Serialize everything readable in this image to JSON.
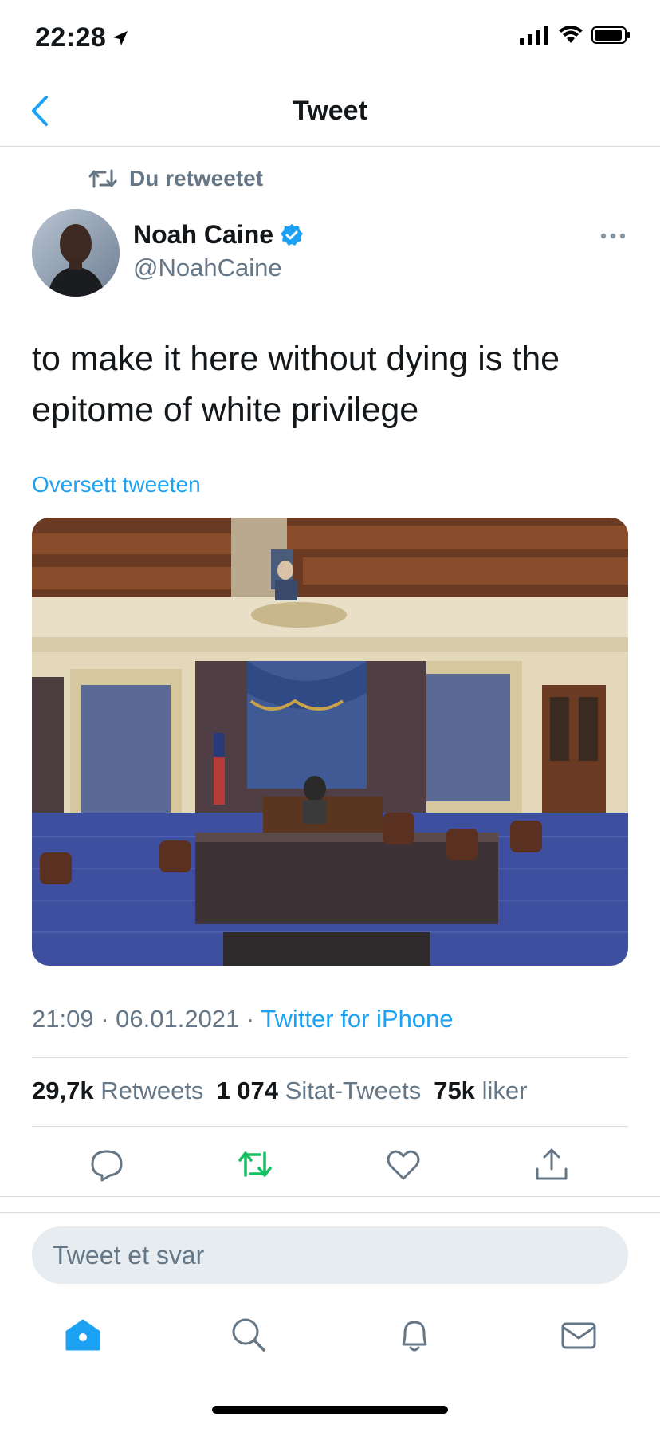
{
  "status_bar": {
    "time": "22:28"
  },
  "nav": {
    "title": "Tweet"
  },
  "retweet_notice": "Du retweetet",
  "author": {
    "name": "Noah Caine",
    "handle": "@NoahCaine"
  },
  "tweet": {
    "text": "to make it here without dying is the epitome of white privilege",
    "translate_label": "Oversett tweeten",
    "time": "21:09",
    "date": "06.01.2021",
    "source": "Twitter for iPhone"
  },
  "stats": {
    "retweets_count": "29,7k",
    "retweets_label": "Retweets",
    "quotes_count": "1 074",
    "quotes_label": "Sitat-Tweets",
    "likes_count": "75k",
    "likes_label": "liker"
  },
  "reply": {
    "placeholder": "Tweet et svar"
  },
  "colors": {
    "accent": "#1da1f2",
    "retweet_green": "#17bf63",
    "muted": "#657786"
  },
  "icons": [
    "back-chevron-icon",
    "retweet-icon",
    "verified-badge-icon",
    "more-icon",
    "reply-icon",
    "retweet-action-icon",
    "like-icon",
    "share-icon",
    "home-icon",
    "search-icon",
    "notifications-icon",
    "messages-icon"
  ]
}
